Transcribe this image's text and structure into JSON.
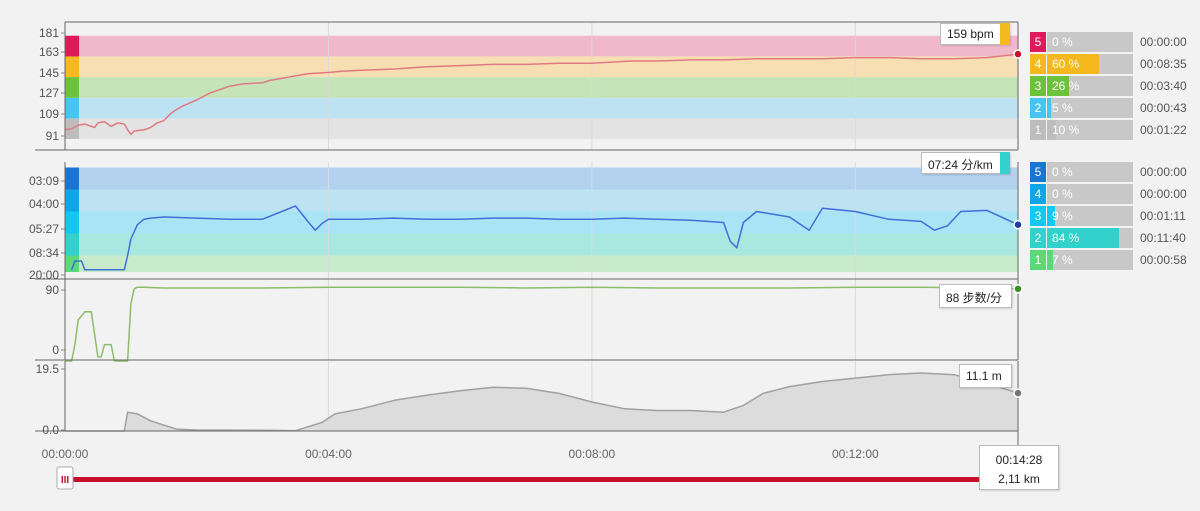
{
  "chart_data": [
    {
      "type": "area",
      "x_unit": "minutes",
      "xlim": [
        0,
        14.47
      ],
      "ylim": [
        82,
        184
      ],
      "yticks": [
        "181",
        "163",
        "145",
        "127",
        "109",
        "91"
      ],
      "zone_bounds": [
        82,
        100,
        118,
        136,
        154,
        172,
        184
      ],
      "zone_colors": [
        "#e3e3e3",
        "#bde2f1",
        "#c5e4b8",
        "#f7dfb3",
        "#f1b8cc"
      ],
      "zone_key_colors": [
        "#bdbdbd",
        "#47c5f2",
        "#6cc23a",
        "#f5b81d",
        "#e0195a"
      ],
      "line_color": "#e07a82",
      "marker_color": "#c8102e",
      "series": [
        {
          "x": [
            0,
            0.1,
            0.2,
            0.3,
            0.45,
            0.5,
            0.6,
            0.7,
            0.8,
            0.9,
            0.95,
            1.0,
            1.05,
            1.2,
            1.3,
            1.4,
            1.5,
            1.6,
            1.7,
            1.8,
            2.0,
            2.2,
            2.5,
            2.7,
            3.0,
            3.1,
            3.3,
            3.5,
            3.7,
            4.0,
            4.2,
            4.5,
            5.0,
            5.5,
            6.0,
            6.5,
            7.0,
            7.5,
            8.0,
            8.3,
            8.6,
            9.0,
            9.5,
            9.8,
            10.0,
            10.5,
            11.0,
            11.5,
            12.0,
            12.5,
            13.0,
            13.5,
            14.0,
            14.47
          ],
          "y": [
            90,
            91,
            94,
            95,
            92,
            96,
            97,
            93,
            96,
            95,
            90,
            86,
            89,
            90,
            92,
            96,
            98,
            104,
            108,
            111,
            116,
            122,
            128,
            130,
            131,
            133,
            135,
            137,
            139,
            140,
            141,
            142,
            143,
            145,
            146,
            147,
            147,
            148,
            148,
            149,
            150,
            150,
            151,
            151,
            151,
            152,
            152,
            152,
            153,
            153,
            152,
            152,
            153,
            156
          ]
        }
      ],
      "tooltip": "159 bpm",
      "tooltip_color": "#f5b81d"
    },
    {
      "type": "area",
      "x_unit": "minutes",
      "xlim": [
        0,
        14.47
      ],
      "ylim": [
        0,
        10
      ],
      "yticks": [
        "03:09",
        "04:00",
        "05:27",
        "08:34",
        "20:00"
      ],
      "zone_bounds": [
        0,
        1.5,
        3.5,
        5.5,
        7.5,
        9.5,
        10
      ],
      "zone_colors": [
        "#c7ebca",
        "#a9e8e0",
        "#a9e4f6",
        "#bde2f1",
        "#b3d2ef"
      ],
      "zone_key_colors": [
        "#5dd878",
        "#32d1cc",
        "#12c8f1",
        "#0ea6e6",
        "#1a74d2"
      ],
      "line_color": "#3f6fd8",
      "marker_color": "#1e3aa0",
      "series": [
        {
          "x": [
            0.1,
            0.15,
            0.25,
            0.3,
            0.9,
            0.95,
            1.0,
            1.1,
            1.2,
            1.3,
            1.5,
            2.0,
            2.5,
            3.0,
            3.5,
            3.7,
            3.8,
            3.9,
            4.0,
            4.5,
            5.0,
            5.5,
            6.0,
            6.5,
            7.0,
            7.5,
            8.0,
            8.5,
            9.0,
            9.5,
            10.0,
            10.1,
            10.2,
            10.3,
            10.5,
            11.0,
            11.3,
            11.5,
            12.0,
            12.5,
            13.0,
            13.2,
            13.4,
            13.6,
            14.0,
            14.47
          ],
          "y": [
            0.2,
            1.0,
            1.0,
            0.2,
            0.2,
            1.5,
            3.0,
            4.3,
            4.8,
            4.9,
            5.0,
            4.9,
            4.8,
            4.8,
            6.0,
            4.5,
            3.8,
            4.4,
            4.8,
            4.8,
            4.9,
            4.8,
            4.8,
            4.9,
            4.9,
            4.8,
            4.8,
            4.9,
            4.8,
            4.7,
            4.5,
            2.8,
            2.2,
            4.5,
            5.5,
            5.0,
            3.8,
            5.8,
            5.5,
            4.8,
            4.6,
            3.8,
            4.2,
            5.5,
            5.6,
            4.3
          ]
        }
      ],
      "tooltip": "07:24 分/km",
      "tooltip_color": "#32d1cc"
    },
    {
      "type": "line",
      "x_unit": "minutes",
      "xlim": [
        0,
        14.47
      ],
      "ylim": [
        0,
        100
      ],
      "yticks": [
        "90",
        "0"
      ],
      "line_color": "#8bbd6b",
      "marker_color": "#3f8f2f",
      "series": [
        {
          "x": [
            0,
            0.1,
            0.15,
            0.2,
            0.3,
            0.4,
            0.5,
            0.55,
            0.6,
            0.7,
            0.75,
            0.8,
            0.85,
            0.95,
            1.0,
            1.05,
            1.1,
            1.2,
            1.5,
            2.0,
            3.0,
            4.0,
            5.0,
            6.0,
            7.0,
            8.0,
            9.0,
            10.0,
            11.0,
            12.0,
            13.0,
            14.0,
            14.47
          ],
          "y": [
            0,
            0,
            20,
            50,
            60,
            60,
            5,
            5,
            20,
            20,
            0,
            0,
            0,
            0,
            70,
            88,
            90,
            90,
            89,
            89,
            89,
            90,
            90,
            90,
            89,
            90,
            89,
            89,
            89,
            90,
            90,
            89,
            88
          ]
        }
      ],
      "tooltip": "88 步数/分"
    },
    {
      "type": "area",
      "x_unit": "minutes",
      "xlim": [
        0,
        14.47
      ],
      "ylim": [
        0,
        20.5
      ],
      "yticks": [
        "19.5",
        "0.0"
      ],
      "line_color": "#a0a0a0",
      "fill_color": "#dcdcdc",
      "marker_color": "#777777",
      "series": [
        {
          "x": [
            0,
            0.9,
            0.95,
            1.1,
            1.3,
            1.7,
            2.0,
            3.0,
            3.5,
            3.9,
            4.1,
            4.5,
            5.0,
            5.5,
            6.0,
            6.5,
            7.0,
            7.5,
            8.0,
            8.5,
            9.0,
            9.5,
            10.0,
            10.3,
            10.6,
            11.0,
            11.5,
            12.0,
            12.5,
            13.0,
            13.5,
            14.0,
            14.47
          ],
          "y": [
            0,
            0,
            5.5,
            5.0,
            3.0,
            0.5,
            0.3,
            0.2,
            0.1,
            2.5,
            5.0,
            6.5,
            9.0,
            10.5,
            11.8,
            12.8,
            12.5,
            11.0,
            8.5,
            6.5,
            6.0,
            6.0,
            5.5,
            7.5,
            11.0,
            13.0,
            14.5,
            15.5,
            16.5,
            17.0,
            16.5,
            14.0,
            11.1
          ]
        }
      ],
      "tooltip": "11.1 m"
    }
  ],
  "x_axis": {
    "ticks": [
      "00:00:00",
      "00:04:00",
      "00:08:00",
      "00:12:00"
    ],
    "tick_minutes": [
      0,
      4,
      8,
      12
    ]
  },
  "cursor": {
    "time": "00:14:28",
    "distance": "2,11 km"
  },
  "slider": {
    "handle_label": "III",
    "color": "#c8102e",
    "position": 1.0
  },
  "zones": {
    "heart_rate": [
      {
        "zone": "5",
        "percent": "0 %",
        "fraction": 0.0,
        "time": "00:00:00",
        "color": "#e0195a"
      },
      {
        "zone": "4",
        "percent": "60 %",
        "fraction": 0.6,
        "time": "00:08:35",
        "color": "#f5b81d"
      },
      {
        "zone": "3",
        "percent": "26 %",
        "fraction": 0.26,
        "time": "00:03:40",
        "color": "#6cc23a"
      },
      {
        "zone": "2",
        "percent": "5 %",
        "fraction": 0.05,
        "time": "00:00:43",
        "color": "#47c5f2"
      },
      {
        "zone": "1",
        "percent": "10 %",
        "fraction": 0.1,
        "time": "00:01:22",
        "color": "#bdbdbd"
      }
    ],
    "pace": [
      {
        "zone": "5",
        "percent": "0 %",
        "fraction": 0.0,
        "time": "00:00:00",
        "color": "#1a74d2"
      },
      {
        "zone": "4",
        "percent": "0 %",
        "fraction": 0.0,
        "time": "00:00:00",
        "color": "#0ea6e6"
      },
      {
        "zone": "3",
        "percent": "9 %",
        "fraction": 0.09,
        "time": "00:01:11",
        "color": "#12c8f1"
      },
      {
        "zone": "2",
        "percent": "84 %",
        "fraction": 0.84,
        "time": "00:11:40",
        "color": "#32d1cc"
      },
      {
        "zone": "1",
        "percent": "7 %",
        "fraction": 0.07,
        "time": "00:00:58",
        "color": "#5dd878"
      }
    ]
  }
}
